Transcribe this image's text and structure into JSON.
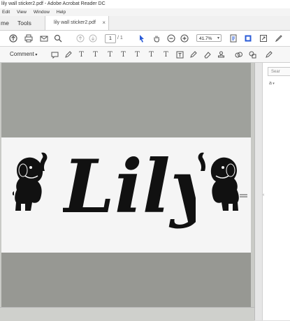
{
  "window": {
    "title": "lily wall sticker2.pdf - Adobe Acrobat Reader DC",
    "menu": [
      "Edit",
      "View",
      "Window",
      "Help"
    ]
  },
  "tabs": {
    "home": "me",
    "tools": "Tools",
    "document": "lily wall sticker2.pdf",
    "close": "×"
  },
  "toolbar": {
    "page_current": "1",
    "page_total": "/ 1",
    "zoom": "41.7%"
  },
  "comment_toolbar": {
    "label": "Comment",
    "tool_glyphs": [
      "T",
      "T",
      "T",
      "T",
      "T",
      "T",
      "T"
    ]
  },
  "document": {
    "sticker_name": "Lily"
  },
  "right_panel": {
    "search_placeholder": "Sear",
    "tool_label": "a",
    "divider_glyph": "‹"
  }
}
